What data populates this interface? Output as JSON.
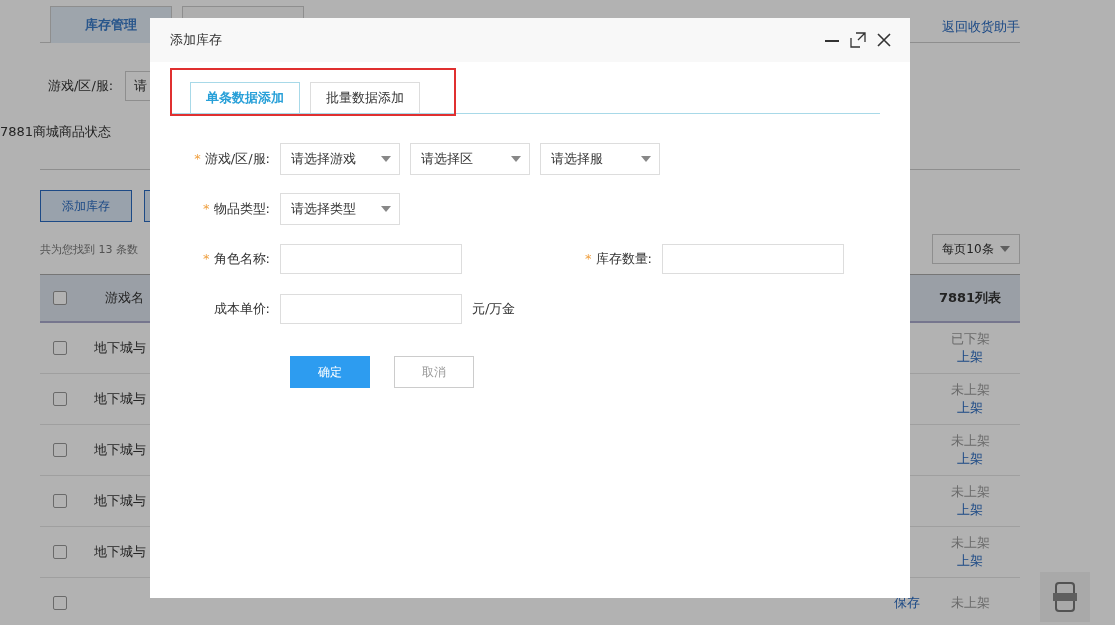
{
  "page": {
    "tabs": [
      {
        "label": "库存管理",
        "selected": true
      }
    ],
    "back_link": "返回收货助手",
    "filter": {
      "label": "游戏/区/服:",
      "select_value": "请"
    },
    "status_label": "7881商城商品状态",
    "actions": [
      "添加库存"
    ],
    "result_count": "共为您找到 13 条数",
    "page_size": "每页10条",
    "table": {
      "header_checked": false,
      "columns": [
        "游戏名",
        "7881列表"
      ],
      "rows": [
        {
          "checked": false,
          "game": "地下城与",
          "status": "已下架",
          "list_action": "上架"
        },
        {
          "checked": false,
          "game": "地下城与",
          "status": "未上架",
          "list_action": "上架"
        },
        {
          "checked": false,
          "game": "地下城与",
          "status": "未上架",
          "list_action": "上架"
        },
        {
          "checked": false,
          "game": "地下城与",
          "status": "未上架",
          "list_action": "上架"
        },
        {
          "checked": false,
          "game": "地下城与",
          "status": "未上架",
          "list_action": "上架"
        },
        {
          "checked": false,
          "op": "保存",
          "status": "未上架"
        }
      ]
    }
  },
  "dialog": {
    "title": "添加库存",
    "tabs": [
      {
        "label": "单条数据添加",
        "selected": true
      },
      {
        "label": "批量数据添加",
        "selected": false
      }
    ],
    "fields": [
      {
        "kind": "selects",
        "required_mark": "*",
        "label": "游戏/区/服:",
        "options": [
          "请选择游戏",
          "请选择区",
          "请选择服"
        ]
      },
      {
        "kind": "selects",
        "required_mark": "*",
        "label": "物品类型:",
        "options": [
          "请选择类型"
        ]
      },
      {
        "kind": "pair",
        "required_mark": "*",
        "label": "角色名称:",
        "second_required_mark": "*",
        "second_label": "库存数量:"
      },
      {
        "kind": "input",
        "label": "成本单价:",
        "unit": "元/万金"
      }
    ],
    "buttons": [
      {
        "label": "确定",
        "kind": "primary"
      },
      {
        "label": "取消",
        "kind": "secondary"
      }
    ]
  }
}
